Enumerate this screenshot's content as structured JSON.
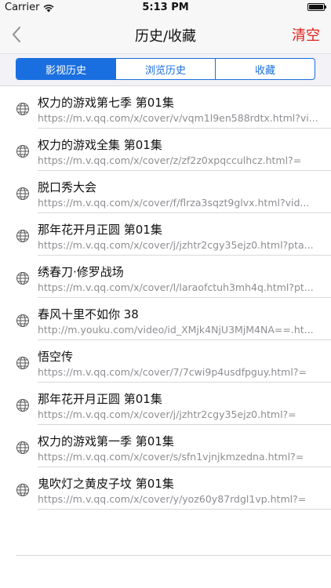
{
  "status_bar": {
    "carrier": "Carrier",
    "time": "5:13 PM"
  },
  "nav": {
    "title": "历史/收藏",
    "clear_label": "清空"
  },
  "tabs": [
    {
      "label": "影视历史",
      "active": true
    },
    {
      "label": "浏览历史",
      "active": false
    },
    {
      "label": "收藏",
      "active": false
    }
  ],
  "colors": {
    "accent": "#1a6fe0",
    "destructive": "#e0201b",
    "secondary_text": "#8e8e93"
  },
  "items": [
    {
      "title": "权力的游戏第七季 第01集",
      "url": "https://m.v.qq.com/x/cover/v/vqm1l9en588rdtx.html?vi..."
    },
    {
      "title": "权力的游戏全集 第01集",
      "url": "https://m.v.qq.com/x/cover/z/zf2z0xpqcculhcz.html?="
    },
    {
      "title": "脱口秀大会",
      "url": "https://m.v.qq.com/x/cover/f/flrza3sqzt9glvx.html?vid..."
    },
    {
      "title": "那年花开月正圆 第01集",
      "url": "https://m.v.qq.com/x/cover/j/jzhtr2cgy35ejz0.html?pta..."
    },
    {
      "title": "绣春刀·修罗战场",
      "url": "https://m.v.qq.com/x/cover/l/laraofctuh3mh4q.html?pt..."
    },
    {
      "title": "春风十里不如你 38",
      "url": "http://m.youku.com/video/id_XMjk4NjU3MjM4NA==.ht..."
    },
    {
      "title": "悟空传",
      "url": "https://m.v.qq.com/x/cover/7/7cwi9p4usdfpguy.html?="
    },
    {
      "title": "那年花开月正圆 第01集",
      "url": "https://m.v.qq.com/x/cover/j/jzhtr2cgy35ejz0.html?="
    },
    {
      "title": "权力的游戏第一季 第01集",
      "url": "https://m.v.qq.com/x/cover/s/sfn1vjnjkmzedna.html?="
    },
    {
      "title": "鬼吹灯之黄皮子坟 第01集",
      "url": "https://m.v.qq.com/x/cover/y/yoz60y87rdgl1vp.html?="
    }
  ]
}
